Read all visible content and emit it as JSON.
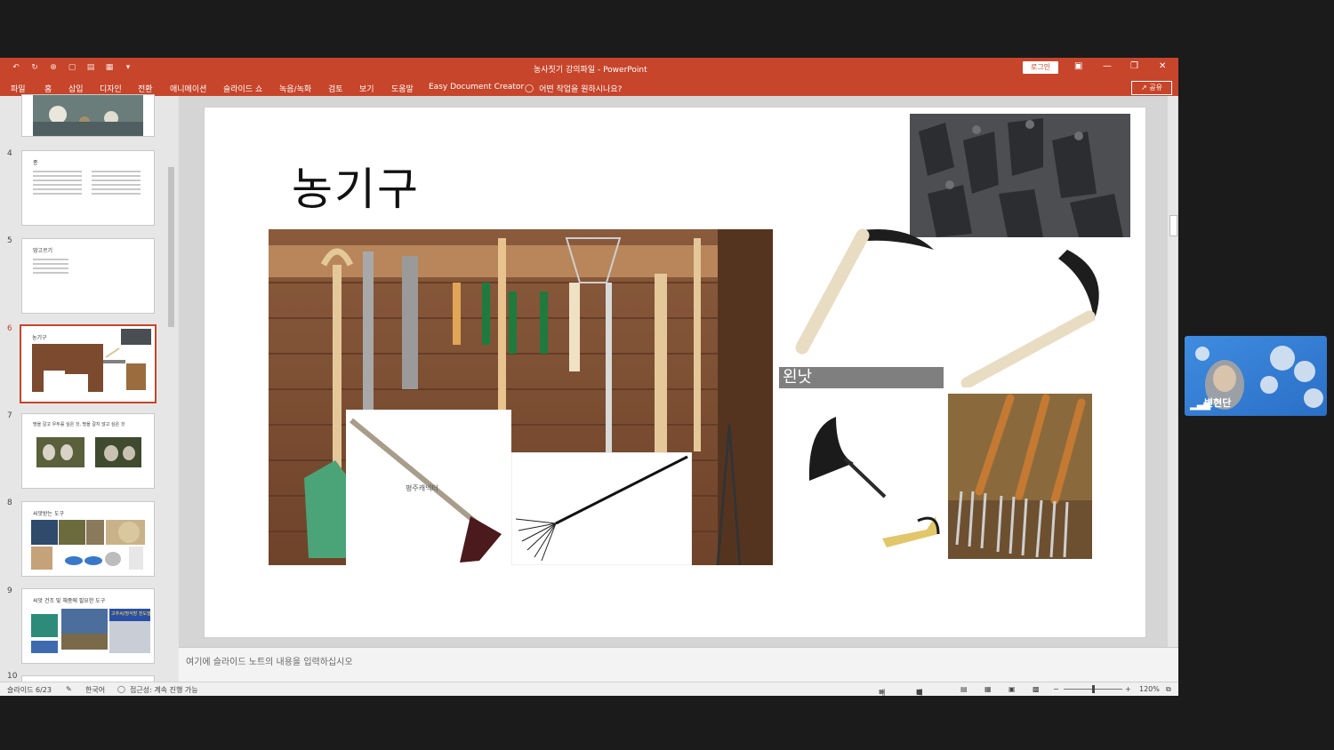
{
  "window": {
    "title": "농사짓기 강의파일  -  PowerPoint",
    "login_label": "로그인",
    "controls": [
      "▣",
      "—",
      "❐",
      "✕"
    ]
  },
  "quick_access": [
    "↶",
    "↻",
    "⊕",
    "▢",
    "▤",
    "▦",
    "▾"
  ],
  "ribbon": {
    "tabs": [
      "파일",
      "홈",
      "삽입",
      "디자인",
      "전환",
      "애니메이션",
      "슬라이드 쇼",
      "녹음/녹화",
      "검토",
      "보기",
      "도움말",
      "Easy Document Creator"
    ],
    "tell_me": "어떤 작업을 원하시나요?",
    "share_label": "공유"
  },
  "thumbnails": [
    {
      "num": "4",
      "title": "종",
      "lines": 12
    },
    {
      "num": "5",
      "title": "땅고르기",
      "lines": 4
    },
    {
      "num": "6",
      "title": "농기구",
      "selected": true
    },
    {
      "num": "7",
      "title": "땅을 갈고 우두를 심은 것, 땅을 갈지 않고 심은 것"
    },
    {
      "num": "8",
      "title": "씨앗받는 도구"
    },
    {
      "num": "9",
      "title": "씨앗 건조 및 채종에 필요한 도구",
      "banner": "고추씨/땅석방 전도말"
    },
    {
      "num": "10"
    }
  ],
  "slide": {
    "title": "농기구",
    "label_box": "왼낫",
    "small_label": "평주캐넥터"
  },
  "notes": {
    "placeholder": "여기에 슬라이드 노트의 내용을 입력하십시오"
  },
  "status": {
    "slide_info": "슬라이드 6/23",
    "language": "한국어",
    "accessibility": "접근성: 계속 진행 가능",
    "notes_btn": "메모",
    "comments_btn": "메모",
    "zoom": "120%"
  },
  "video": {
    "participant": "변현단"
  }
}
